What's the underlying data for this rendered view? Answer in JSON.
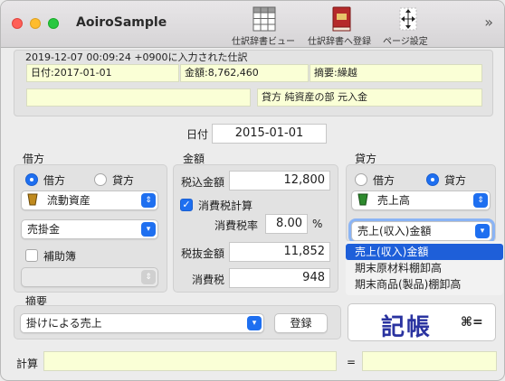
{
  "window": {
    "title": "AoiroSample"
  },
  "toolbar": {
    "items": [
      {
        "label": "仕訳辞書ビュー",
        "icon": "table-grid-icon"
      },
      {
        "label": "仕訳辞書へ登録",
        "icon": "book-icon"
      },
      {
        "label": "ページ設定",
        "icon": "page-setup-icon"
      }
    ],
    "overflow": "»"
  },
  "info": {
    "record_line": "2019-12-07 00:09:24 +0900に入力された仕訳",
    "date_field": "日付:2017-01-01",
    "amount_field": "金額:8,762,460",
    "summary_field": "摘要:繰越",
    "blank_field": "",
    "account_field": "貸方 純資産の部 元入金"
  },
  "date": {
    "label": "日付",
    "value": "2015-01-01"
  },
  "debit": {
    "title": "借方",
    "radio_debit": "借方",
    "radio_credit": "貸方",
    "selected": "借方",
    "category": "流動資産",
    "account": "売掛金",
    "subledger_label": "補助簿",
    "subledger_checked": false,
    "subledger_value": ""
  },
  "amount": {
    "title": "金額",
    "tax_incl_label": "税込金額",
    "tax_incl_value": "12,800",
    "calc_tax_label": "消費税計算",
    "calc_tax_checked": true,
    "rate_label": "消費税率",
    "rate_value": "8.00",
    "rate_unit": "%",
    "tax_excl_label": "税抜金額",
    "tax_excl_value": "11,852",
    "tax_label": "消費税",
    "tax_value": "948"
  },
  "credit": {
    "title": "貸方",
    "radio_debit": "借方",
    "radio_credit": "貸方",
    "selected": "貸方",
    "category": "売上高",
    "account": "売上(収入)金額",
    "menu_items": [
      "売上(収入)金額",
      "期末原材料棚卸高",
      "期末商品(製品)棚卸高"
    ],
    "menu_selected": 0
  },
  "memo": {
    "title": "摘要",
    "value": "掛けによる売上",
    "register_label": "登録"
  },
  "post": {
    "label": "記帳",
    "shortcut": "⌘="
  },
  "calc": {
    "label": "計算",
    "expr": "",
    "equals": "=",
    "result": ""
  },
  "colors": {
    "accent": "#1e6ff0",
    "field_yellow": "#faffd6",
    "post_text": "#2a33a0"
  }
}
